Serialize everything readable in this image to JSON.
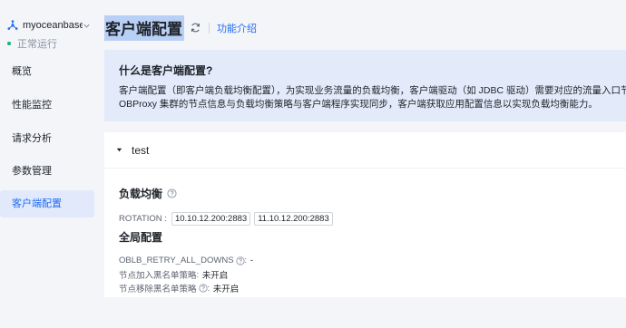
{
  "cluster": {
    "name": "myoceanbase",
    "status": "正常运行"
  },
  "nav": {
    "items": [
      {
        "label": "概览"
      },
      {
        "label": "性能监控"
      },
      {
        "label": "请求分析"
      },
      {
        "label": "参数管理"
      },
      {
        "label": "客户端配置"
      }
    ]
  },
  "header": {
    "title": "客户端配置",
    "intro_link": "功能介绍"
  },
  "info": {
    "title": "什么是客户端配置?",
    "desc_line1": "客户端配置（即客户端负载均衡配置），为实现业务流量的负载均衡，客户端驱动（如 JDBC 驱动）需要对应的流量入口节点及对应流量分配",
    "desc_line2": "OBProxy 集群的节点信息与负载均衡策略与客户端程序实现同步，客户端获取应用配置信息以实现负载均衡能力。"
  },
  "panel": {
    "name": "test",
    "load_balance": {
      "title": "负载均衡",
      "rotation_label": "ROTATION :",
      "ips": [
        "10.10.12.200:2883",
        "11.10.12.200:2883"
      ]
    },
    "global_config": {
      "title": "全局配置",
      "retry_label": "OBLB_RETRY_ALL_DOWNS",
      "retry_value": "-",
      "join_blacklist_label": "节点加入黑名单策略",
      "join_blacklist_value": "未开启",
      "remove_blacklist_label": "节点移除黑名单策略",
      "remove_blacklist_value": "未开启"
    }
  },
  "colors": {
    "accent": "#1f6cf5",
    "status_ok": "#12b76a",
    "info_bg": "#e3ebfa",
    "selection": "#b8cff6"
  },
  "icons": [
    "cluster-icon",
    "chevron-down-icon",
    "refresh-icon",
    "caret-down-icon",
    "help-icon"
  ]
}
